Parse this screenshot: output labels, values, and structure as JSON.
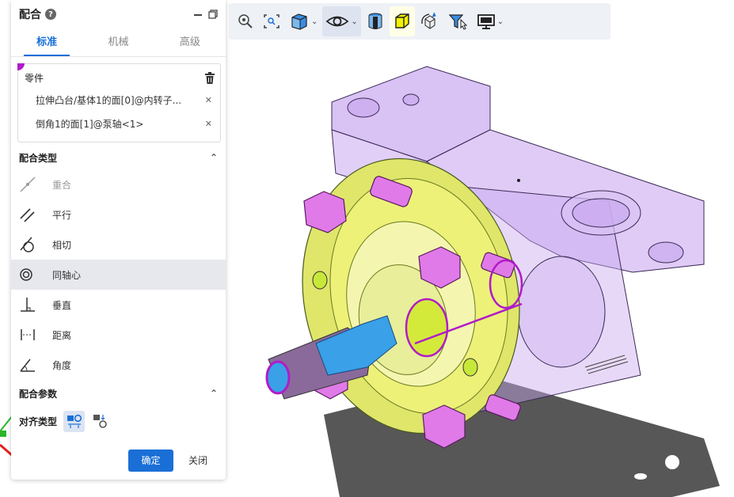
{
  "panel": {
    "title": "配合",
    "tabs": [
      {
        "label": "标准",
        "active": true
      },
      {
        "label": "机械",
        "active": false
      },
      {
        "label": "高级",
        "active": false
      }
    ],
    "parts": {
      "label": "零件",
      "items": [
        "拉伸凸台/基体1的面[0]@内转子...",
        "倒角1的面[1]@泵轴<1>"
      ]
    },
    "mate_type": {
      "label": "配合类型",
      "items": [
        {
          "label": "重合",
          "icon": "coincident-icon",
          "state": "disabled"
        },
        {
          "label": "平行",
          "icon": "parallel-icon",
          "state": "normal"
        },
        {
          "label": "相切",
          "icon": "tangent-icon",
          "state": "normal"
        },
        {
          "label": "同轴心",
          "icon": "concentric-icon",
          "state": "selected"
        },
        {
          "label": "垂直",
          "icon": "perpendicular-icon",
          "state": "normal"
        },
        {
          "label": "距离",
          "icon": "distance-icon",
          "state": "normal"
        },
        {
          "label": "角度",
          "icon": "angle-icon",
          "state": "normal"
        }
      ]
    },
    "mate_params": {
      "label": "配合参数",
      "align_label": "对齐类型"
    },
    "ok_label": "确定",
    "close_label": "关闭"
  },
  "colors": {
    "accent": "#1a6fd6",
    "selection": "#b01cc8",
    "housing": "#c9a8f0",
    "cover": "#eef27a",
    "shaft": "#3aa0e8",
    "bolts": "#e07ae8"
  },
  "toolbar": {
    "items": [
      "zoom-fit-icon",
      "zoom-area-icon",
      "view-orientation-icon",
      "display-style-icon",
      "hide-show-icon",
      "section-view-icon",
      "appearance-icon",
      "rotate-view-icon",
      "filter-icon",
      "display-settings-icon"
    ]
  }
}
